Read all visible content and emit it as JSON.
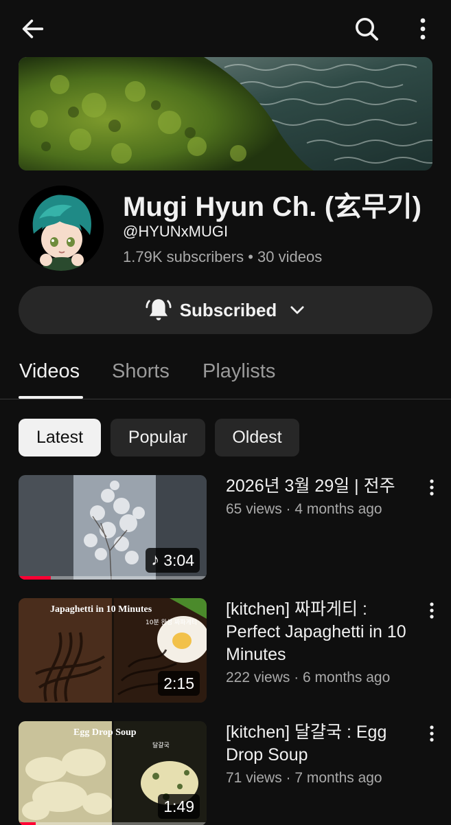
{
  "header": {
    "back_icon": "arrow-left-icon",
    "search_icon": "search-icon",
    "more_icon": "more-vertical-icon"
  },
  "channel": {
    "name": "Mugi Hyun Ch. (玄무기)",
    "handle": "@HYUNxMUGI",
    "stats": "1.79K subscribers • 30 videos",
    "subscribe_label": "Subscribed"
  },
  "tabs": [
    {
      "label": "Videos",
      "active": true
    },
    {
      "label": "Shorts",
      "active": false
    },
    {
      "label": "Playlists",
      "active": false
    }
  ],
  "filters": [
    {
      "label": "Latest",
      "active": true
    },
    {
      "label": "Popular",
      "active": false
    },
    {
      "label": "Oldest",
      "active": false
    }
  ],
  "videos": [
    {
      "title": "2026년 3월 29일 | 전주",
      "meta": "65 views · 4 months ago",
      "duration": "3:04",
      "is_short_audio": true,
      "watched_fraction": 0.17,
      "thumb_text": ""
    },
    {
      "title": "[kitchen] 짜파게티 : Perfect Japaghetti in 10 Minutes",
      "meta": "222 views · 6 months ago",
      "duration": "2:15",
      "watched_fraction": 0,
      "thumb_text": "Japaghetti in 10 Minutes",
      "thumb_subtext": "10분 완성 짜파게티"
    },
    {
      "title": "[kitchen] 달걀국 : Egg Drop Soup",
      "meta": "71 views · 7 months ago",
      "duration": "1:49",
      "watched_fraction": 0.09,
      "thumb_text": "Egg Drop Soup",
      "thumb_subtext": "달걀국"
    }
  ],
  "colors": {
    "background": "#0f0f0f",
    "chip_bg": "#272727",
    "progress": "#ff0033",
    "text_secondary": "#aaaaaa"
  }
}
